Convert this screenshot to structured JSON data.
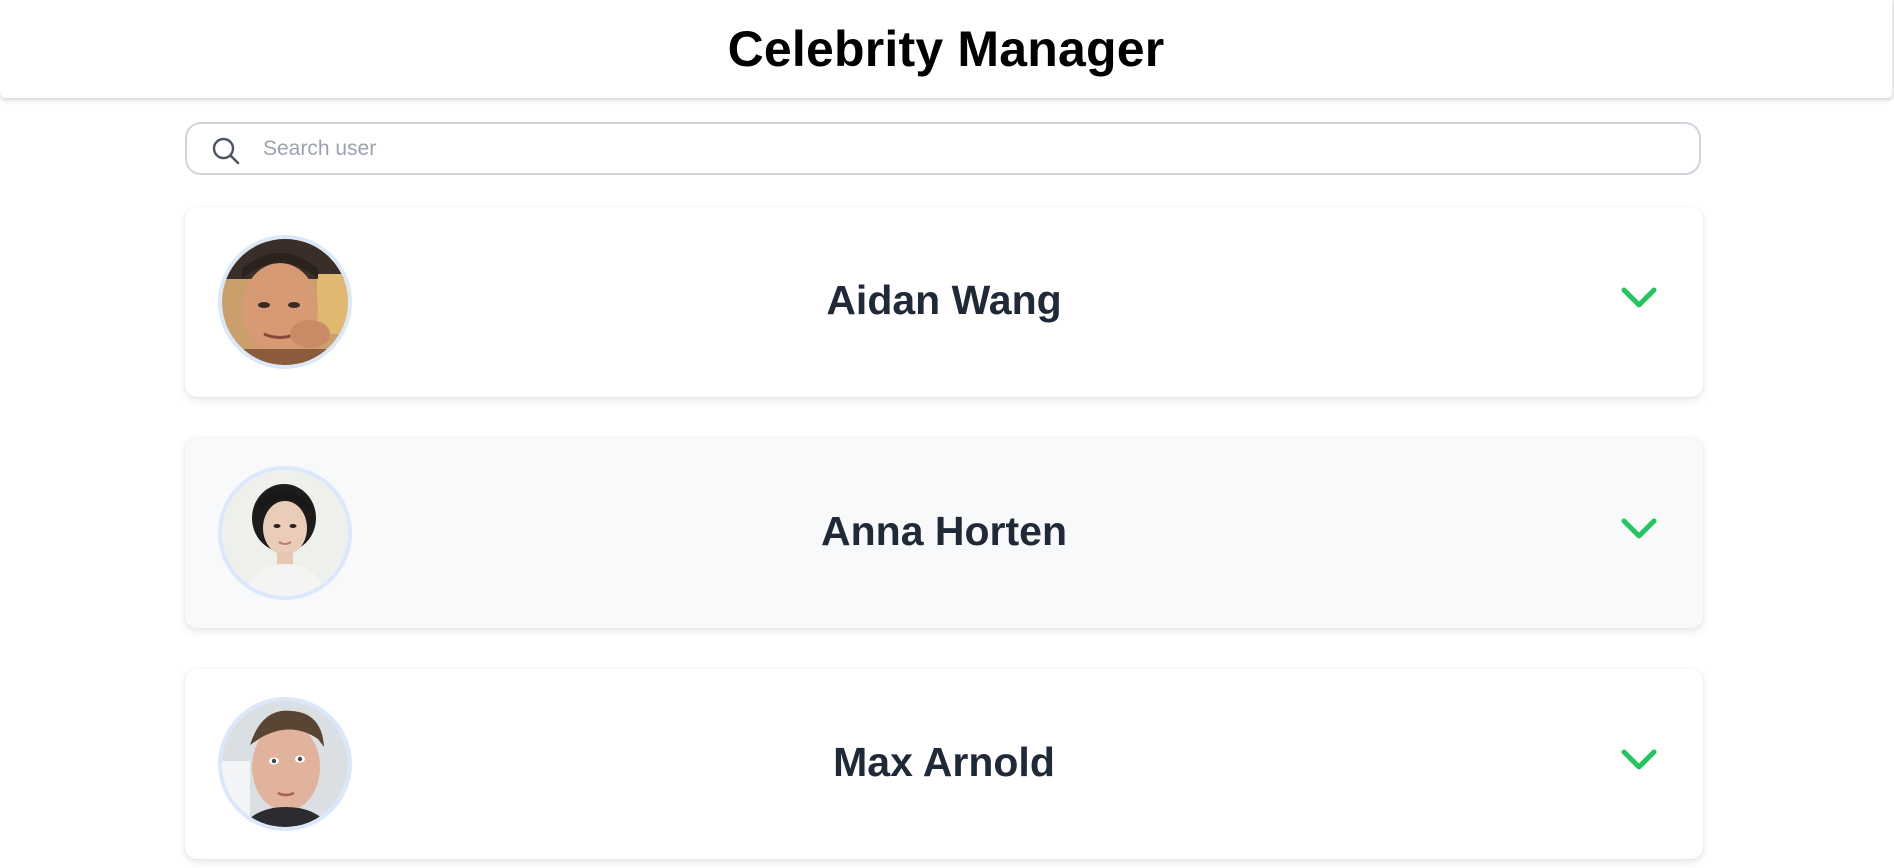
{
  "app": {
    "title": "Celebrity Manager"
  },
  "search": {
    "placeholder": "Search user",
    "value": "",
    "icon": "search-icon"
  },
  "users": [
    {
      "name": "Aidan Wang",
      "avatar": "user-photo",
      "expand_icon": "chevron-down-icon"
    },
    {
      "name": "Anna Horten",
      "avatar": "user-photo",
      "expand_icon": "chevron-down-icon"
    },
    {
      "name": "Max Arnold",
      "avatar": "user-photo",
      "expand_icon": "chevron-down-icon"
    }
  ],
  "colors": {
    "accent": "#22c55e",
    "avatar_ring": "#dbe7fb",
    "name_text": "#1f2937"
  }
}
